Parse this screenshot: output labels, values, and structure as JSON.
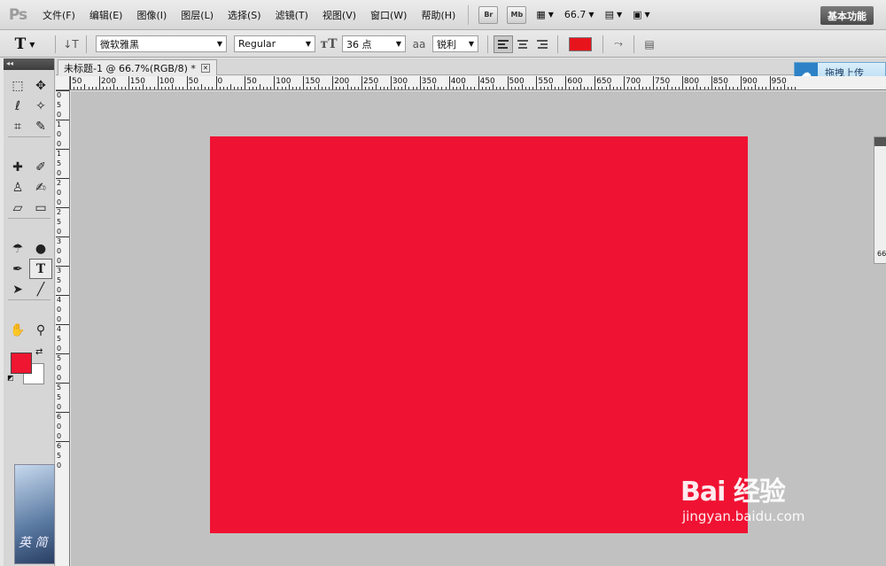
{
  "app": {
    "logo": "Ps"
  },
  "menu": {
    "items": [
      "文件(F)",
      "编辑(E)",
      "图像(I)",
      "图层(L)",
      "选择(S)",
      "滤镜(T)",
      "视图(V)",
      "窗口(W)",
      "帮助(H)"
    ],
    "bridge_label": "Br",
    "minibridge_label": "Mb",
    "zoom_value": "66.7",
    "workspace_label": "基本功能"
  },
  "options": {
    "tool_glyph": "T",
    "font_family": "微软雅黑",
    "font_style": "Regular",
    "font_size": "36 点",
    "aa_label": "aa",
    "antialias": "锐利",
    "text_color": "#e8141c"
  },
  "tools": {
    "panel_collapse": "◂◂",
    "items": [
      {
        "name": "marquee",
        "glyph": "⬚"
      },
      {
        "name": "move",
        "glyph": "✥"
      },
      {
        "name": "lasso",
        "glyph": "ℓ"
      },
      {
        "name": "magic-wand",
        "glyph": "✧"
      },
      {
        "name": "crop",
        "glyph": "⌗"
      },
      {
        "name": "eyedropper",
        "glyph": "✎"
      },
      {
        "name": "spot-healing",
        "glyph": "✚"
      },
      {
        "name": "brush",
        "glyph": "✐"
      },
      {
        "name": "clone-stamp",
        "glyph": "♙"
      },
      {
        "name": "history-brush",
        "glyph": "✍"
      },
      {
        "name": "eraser",
        "glyph": "▱"
      },
      {
        "name": "gradient",
        "glyph": "▭"
      },
      {
        "name": "blur",
        "glyph": "☂"
      },
      {
        "name": "dodge",
        "glyph": "●"
      },
      {
        "name": "pen",
        "glyph": "✒"
      },
      {
        "name": "type",
        "glyph": "T"
      },
      {
        "name": "path-selection",
        "glyph": "➤"
      },
      {
        "name": "line",
        "glyph": "╱"
      },
      {
        "name": "hand",
        "glyph": "✋"
      },
      {
        "name": "zoom",
        "glyph": "⚲"
      }
    ],
    "foreground_color": "#ef1631",
    "background_color": "#ffffff",
    "promo_text": "英 简"
  },
  "document": {
    "tab_title": "未标题-1 @ 66.7%(RGB/8) *",
    "canvas_color": "#f01233",
    "upload_label": "拖拽上传",
    "ruler_top_labels": [
      "50",
      "200",
      "150",
      "100",
      "50",
      "0",
      "50",
      "100",
      "150",
      "200",
      "250",
      "300",
      "350",
      "400",
      "450",
      "500",
      "550",
      "600",
      "650",
      "700",
      "750",
      "800",
      "850",
      "900",
      "950"
    ],
    "ruler_left_labels": [
      "0",
      "5",
      "0",
      "1",
      "0",
      "0",
      "1",
      "5",
      "0",
      "2",
      "0",
      "0",
      "2",
      "5",
      "0",
      "3",
      "0",
      "0",
      "3",
      "5",
      "0",
      "4",
      "0",
      "0",
      "4",
      "5",
      "0",
      "5",
      "0",
      "0",
      "5",
      "5",
      "0",
      "6",
      "0",
      "0",
      "6",
      "5",
      "0"
    ],
    "side_panel_value": "66"
  },
  "watermark": {
    "main": "Bai 经验",
    "sub": "jingyan.baidu.com"
  }
}
